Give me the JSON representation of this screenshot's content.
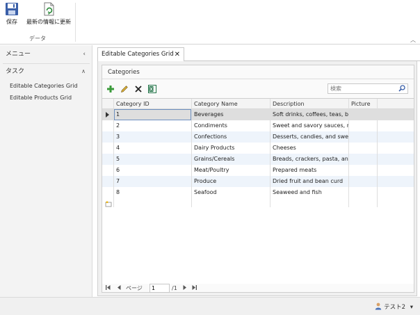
{
  "ribbon": {
    "save_label": "保存",
    "refresh_label": "最新の情報に更新",
    "group_label": "データ",
    "collapse_glyph": "︿"
  },
  "nav": {
    "menu_label": "メニュー",
    "tasks_label": "タスク",
    "items": [
      {
        "label": "Editable Categories Grid"
      },
      {
        "label": "Editable Products Grid"
      }
    ]
  },
  "tab": {
    "title": "Editable Categories Grid"
  },
  "panel": {
    "title": "Categories",
    "search_placeholder": "検索"
  },
  "grid": {
    "columns": [
      "Category ID",
      "Category Name",
      "Description",
      "Picture"
    ],
    "rows": [
      {
        "id": "1",
        "name": "Beverages",
        "description": "Soft drinks, coffees, teas, beer"
      },
      {
        "id": "2",
        "name": "Condiments",
        "description": "Sweet and savory sauces, relis"
      },
      {
        "id": "3",
        "name": "Confections",
        "description": "Desserts, candies, and sweet b"
      },
      {
        "id": "4",
        "name": "Dairy Products",
        "description": "Cheeses"
      },
      {
        "id": "5",
        "name": "Grains/Cereals",
        "description": "Breads, crackers, pasta, and ce"
      },
      {
        "id": "6",
        "name": "Meat/Poultry",
        "description": "Prepared meats"
      },
      {
        "id": "7",
        "name": "Produce",
        "description": "Dried fruit and bean curd"
      },
      {
        "id": "8",
        "name": "Seafood",
        "description": "Seaweed and fish"
      }
    ]
  },
  "pager": {
    "page_label": "ページ",
    "current_page": "1",
    "total": "/1"
  },
  "status": {
    "user": "テスト2"
  },
  "colors": {
    "accent": "#2e7d32",
    "selected_row": "#dedede",
    "alt_row": "#eef4fb",
    "focus_border": "#6d8fbf"
  },
  "icons": [
    "save-icon",
    "refresh-icon",
    "add-icon",
    "edit-icon",
    "delete-icon",
    "export-excel-icon",
    "search-icon",
    "new-row-icon",
    "user-icon"
  ]
}
